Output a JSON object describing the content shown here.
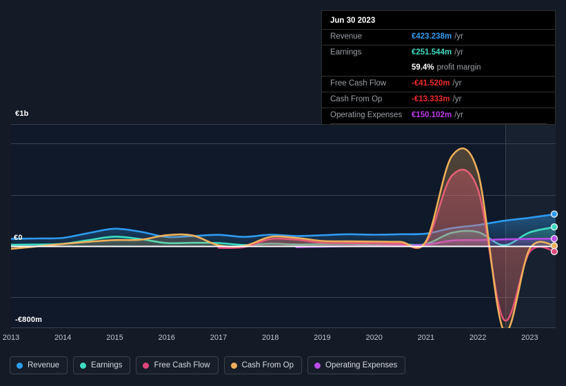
{
  "theme": {
    "background": "#151b26",
    "plot_background": "#10192a",
    "forecast_background": "#17212f",
    "gridline": "#3b4250",
    "zero_line": "#ffffff"
  },
  "tooltip": {
    "title": "Jun 30 2023",
    "unit_suffix": "/yr",
    "rows": [
      {
        "label": "Revenue",
        "value": "€423.238m",
        "unit": "/yr",
        "color": "#2e9bf0"
      },
      {
        "label": "Earnings",
        "value": "€251.544m",
        "unit": "/yr",
        "color": "#3ddcc0"
      },
      {
        "label": "",
        "value": "59.4%",
        "unit": "profit margin",
        "color": "#ffffff"
      },
      {
        "label": "Free Cash Flow",
        "value": "-€41.520m",
        "unit": "/yr",
        "color": "#ef2b2b"
      },
      {
        "label": "Cash From Op",
        "value": "-€13.333m",
        "unit": "/yr",
        "color": "#ef2b2b"
      },
      {
        "label": "Operating Expenses",
        "value": "€150.102m",
        "unit": "/yr",
        "color": "#c03bf0"
      }
    ]
  },
  "axes": {
    "y_top_label": "€1b",
    "y_zero_label": "€0",
    "y_bottom_label": "-€800m",
    "y_min": -800,
    "y_max": 1000,
    "x_labels": [
      "2013",
      "2014",
      "2015",
      "2016",
      "2017",
      "2018",
      "2019",
      "2020",
      "2021",
      "2022",
      "2023"
    ]
  },
  "legend": {
    "items": [
      {
        "label": "Revenue",
        "color": "#2e9bf0"
      },
      {
        "label": "Earnings",
        "color": "#3ddcc0"
      },
      {
        "label": "Free Cash Flow",
        "color": "#e0457b"
      },
      {
        "label": "Cash From Op",
        "color": "#efb05a"
      },
      {
        "label": "Operating Expenses",
        "color": "#b94ce8"
      }
    ]
  },
  "chart_data": {
    "type": "line",
    "title": "",
    "xlabel": "",
    "ylabel": "",
    "ylim": [
      -800,
      1000
    ],
    "y_unit": "EUR millions",
    "grid": true,
    "legend_position": "bottom",
    "forecast_region_start_x": "2022.8",
    "x": [
      2013.0,
      2013.5,
      2014.0,
      2014.5,
      2015.0,
      2015.5,
      2016.0,
      2016.5,
      2017.0,
      2017.5,
      2018.0,
      2018.5,
      2019.0,
      2019.5,
      2020.0,
      2020.5,
      2021.0,
      2021.5,
      2022.0,
      2022.5,
      2023.0,
      2023.5
    ],
    "series": [
      {
        "name": "Revenue",
        "color": "#2e9bf0",
        "values": [
          62,
          65,
          70,
          110,
          145,
          120,
          78,
          85,
          95,
          78,
          96,
          85,
          92,
          100,
          96,
          100,
          105,
          150,
          175,
          210,
          235,
          265
        ]
      },
      {
        "name": "Earnings",
        "color": "#3ddcc0",
        "values": [
          14,
          16,
          22,
          52,
          80,
          60,
          28,
          30,
          28,
          12,
          22,
          16,
          18,
          20,
          16,
          18,
          20,
          112,
          118,
          10,
          115,
          160
        ]
      },
      {
        "name": "Free Cash Flow",
        "color": "#e0457b",
        "values": [
          null,
          null,
          null,
          null,
          null,
          null,
          null,
          null,
          -12,
          -5,
          60,
          55,
          30,
          28,
          26,
          24,
          30,
          580,
          470,
          -600,
          -45,
          -42
        ]
      },
      {
        "name": "Cash From Op",
        "color": "#efb05a",
        "values": [
          -20,
          0,
          20,
          38,
          52,
          55,
          92,
          90,
          10,
          5,
          78,
          70,
          45,
          42,
          40,
          38,
          42,
          740,
          610,
          -690,
          -20,
          5
        ]
      },
      {
        "name": "Operating Expenses",
        "color": "#b94ce8",
        "values": [
          null,
          null,
          null,
          null,
          null,
          null,
          null,
          null,
          null,
          null,
          null,
          -6,
          -2,
          2,
          4,
          8,
          14,
          48,
          52,
          58,
          62,
          64
        ]
      }
    ],
    "endpoint_markers": [
      {
        "series": "Revenue",
        "color": "#2e9bf0"
      },
      {
        "series": "Earnings",
        "color": "#3ddcc0"
      },
      {
        "series": "Operating Expenses",
        "color": "#b94ce8"
      },
      {
        "series": "Cash From Op",
        "color": "#efb05a"
      },
      {
        "series": "Free Cash Flow",
        "color": "#e0457b"
      }
    ]
  }
}
